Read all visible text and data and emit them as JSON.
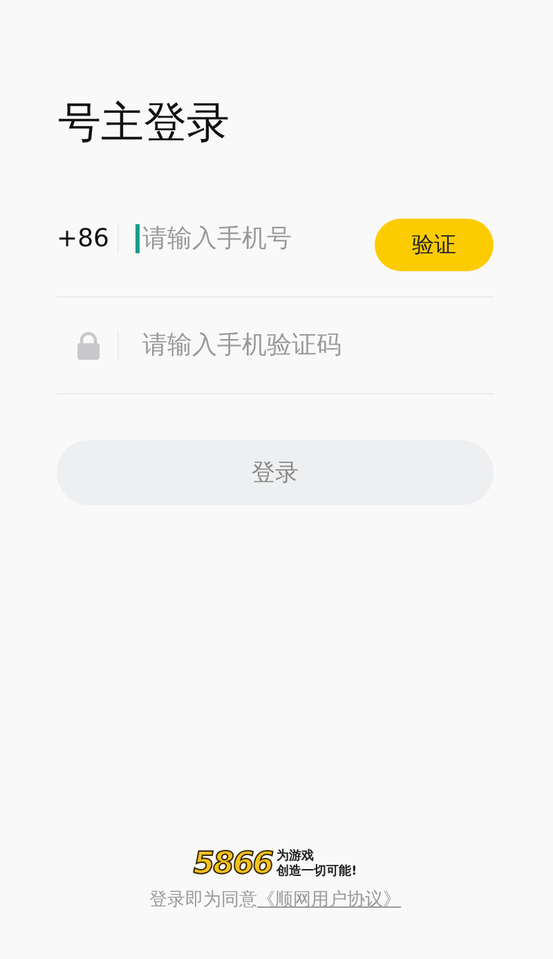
{
  "title": "号主登录",
  "phone": {
    "prefix": "+86",
    "placeholder": "请输入手机号",
    "focused": true
  },
  "verify_button": "验证",
  "code": {
    "placeholder": "请输入手机验证码"
  },
  "login_button": {
    "label": "登录",
    "disabled": true
  },
  "logo": {
    "mark": "5866",
    "slogan": [
      "为游戏",
      "创造一切可能!"
    ]
  },
  "agreement": {
    "text": "登录即为同意",
    "link": "《顺网用户协议》"
  }
}
